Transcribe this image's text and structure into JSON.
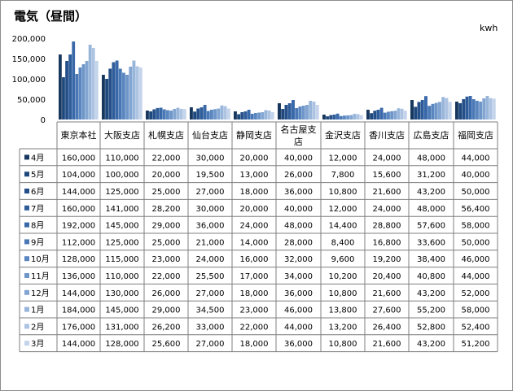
{
  "title": "電気（昼間）",
  "unit": "kwh",
  "chart_data": {
    "type": "bar",
    "title": "電気（昼間）",
    "ylabel": "kwh",
    "ylim": [
      0,
      200000
    ],
    "yticks": [
      "0",
      "50,000",
      "100,000",
      "150,000",
      "200,000"
    ],
    "grid": false,
    "legend": "left table",
    "categories": [
      "東京本社",
      "大阪支店",
      "札幌支店",
      "仙台支店",
      "静岡支店",
      "名古屋支店",
      "金沢支店",
      "香川支店",
      "広島支店",
      "福岡支店"
    ],
    "series": [
      {
        "name": "4月",
        "color": "#17375e",
        "values": [
          160000,
          110000,
          22000,
          30000,
          20000,
          40000,
          12000,
          24000,
          48000,
          44000
        ],
        "labels": [
          "160,000",
          "110,000",
          "22,000",
          "30,000",
          "20,000",
          "40,000",
          "12,000",
          "24,000",
          "48,000",
          "44,000"
        ]
      },
      {
        "name": "5月",
        "color": "#1f497d",
        "values": [
          104000,
          100000,
          20000,
          19500,
          13000,
          26000,
          7800,
          15600,
          31200,
          40000
        ],
        "labels": [
          "104,000",
          "100,000",
          "20,000",
          "19,500",
          "13,000",
          "26,000",
          "7,800",
          "15,600",
          "31,200",
          "40,000"
        ]
      },
      {
        "name": "6月",
        "color": "#254f88",
        "values": [
          144000,
          125000,
          25000,
          27000,
          18000,
          36000,
          10800,
          21600,
          43200,
          50000
        ],
        "labels": [
          "144,000",
          "125,000",
          "25,000",
          "27,000",
          "18,000",
          "36,000",
          "10,800",
          "21,600",
          "43,200",
          "50,000"
        ]
      },
      {
        "name": "7月",
        "color": "#2e5c99",
        "values": [
          160000,
          141000,
          28200,
          30000,
          20000,
          40000,
          12000,
          24000,
          48000,
          56400
        ],
        "labels": [
          "160,000",
          "141,000",
          "28,200",
          "30,000",
          "20,000",
          "40,000",
          "12,000",
          "24,000",
          "48,000",
          "56,400"
        ]
      },
      {
        "name": "8月",
        "color": "#3a69aa",
        "values": [
          192000,
          145000,
          29000,
          36000,
          24000,
          48000,
          14400,
          28800,
          57600,
          58000
        ],
        "labels": [
          "192,000",
          "145,000",
          "29,000",
          "36,000",
          "24,000",
          "48,000",
          "14,400",
          "28,800",
          "57,600",
          "58,000"
        ]
      },
      {
        "name": "9月",
        "color": "#4a78b6",
        "values": [
          112000,
          125000,
          25000,
          21000,
          14000,
          28000,
          8400,
          16800,
          33600,
          50000
        ],
        "labels": [
          "112,000",
          "125,000",
          "25,000",
          "21,000",
          "14,000",
          "28,000",
          "8,400",
          "16,800",
          "33,600",
          "50,000"
        ]
      },
      {
        "name": "10月",
        "color": "#5b87c0",
        "values": [
          128000,
          115000,
          23000,
          24000,
          16000,
          32000,
          9600,
          19200,
          38400,
          46000
        ],
        "labels": [
          "128,000",
          "115,000",
          "23,000",
          "24,000",
          "16,000",
          "32,000",
          "9,600",
          "19,200",
          "38,400",
          "46,000"
        ]
      },
      {
        "name": "11月",
        "color": "#6e96c9",
        "values": [
          136000,
          110000,
          22000,
          25500,
          17000,
          34000,
          10200,
          20400,
          40800,
          44000
        ],
        "labels": [
          "136,000",
          "110,000",
          "22,000",
          "25,500",
          "17,000",
          "34,000",
          "10,200",
          "20,400",
          "40,800",
          "44,000"
        ]
      },
      {
        "name": "12月",
        "color": "#83a5d2",
        "values": [
          144000,
          130000,
          26000,
          27000,
          18000,
          36000,
          10800,
          21600,
          43200,
          52000
        ],
        "labels": [
          "144,000",
          "130,000",
          "26,000",
          "27,000",
          "18,000",
          "36,000",
          "10,800",
          "21,600",
          "43,200",
          "52,000"
        ]
      },
      {
        "name": "1月",
        "color": "#98b5da",
        "values": [
          184000,
          145000,
          29000,
          34500,
          23000,
          46000,
          13800,
          27600,
          55200,
          58000
        ],
        "labels": [
          "184,000",
          "145,000",
          "29,000",
          "34,500",
          "23,000",
          "46,000",
          "13,800",
          "27,600",
          "55,200",
          "58,000"
        ]
      },
      {
        "name": "2月",
        "color": "#adc3e2",
        "values": [
          176000,
          131000,
          26200,
          33000,
          22000,
          44000,
          13200,
          26400,
          52800,
          52400
        ],
        "labels": [
          "176,000",
          "131,000",
          "26,200",
          "33,000",
          "22,000",
          "44,000",
          "13,200",
          "26,400",
          "52,800",
          "52,400"
        ]
      },
      {
        "name": "3月",
        "color": "#c4d4ea",
        "values": [
          144000,
          128000,
          25600,
          27000,
          18000,
          36000,
          10800,
          21600,
          43200,
          51200
        ],
        "labels": [
          "144,000",
          "128,000",
          "25,600",
          "27,000",
          "18,000",
          "36,000",
          "10,800",
          "21,600",
          "43,200",
          "51,200"
        ]
      }
    ]
  }
}
